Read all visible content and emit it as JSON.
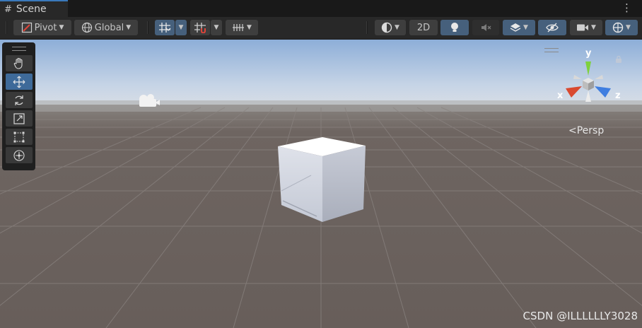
{
  "window": {
    "tab_label": "Scene",
    "tab_icon": "grid-icon",
    "menu_icon": "kebab-menu-icon"
  },
  "toolbar": {
    "pivot_label": "Pivot",
    "global_label": "Global",
    "mode_2d_label": "2D"
  },
  "scene": {
    "view_label": "Persp",
    "gizmo_axes": {
      "x": "x",
      "y": "y",
      "z": "z"
    },
    "tools": [
      "hand-tool",
      "move-tool",
      "rotate-tool",
      "scale-tool",
      "rect-tool",
      "transform-tool"
    ],
    "active_tool": "move-tool"
  },
  "watermark": "CSDN @ILLLLLLY3028",
  "colors": {
    "accent": "#3a79bb",
    "active_button": "#46607c",
    "ground": "#6b625e",
    "sky": "#aabfd8",
    "x_axis": "#d9492f",
    "y_axis": "#7ed13c",
    "z_axis": "#3f7ee0"
  }
}
